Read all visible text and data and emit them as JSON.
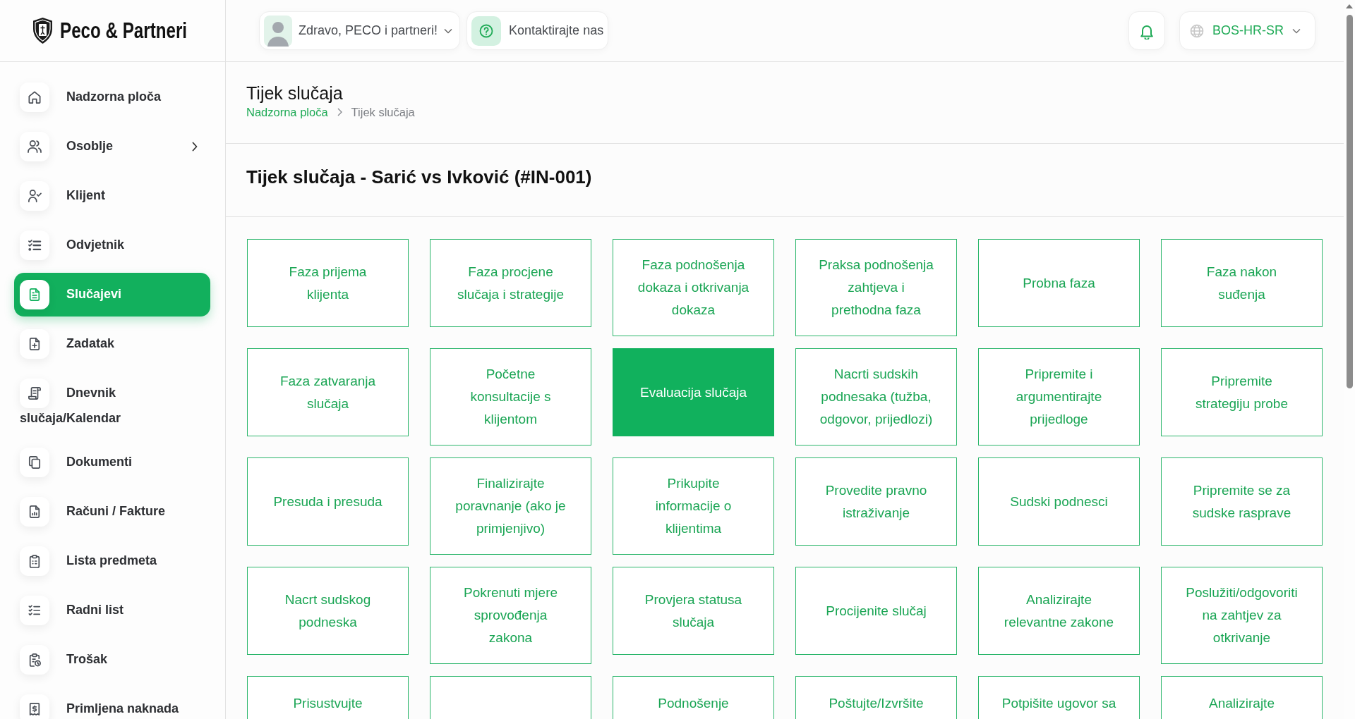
{
  "brand": {
    "name": "Peco & Partneri"
  },
  "sidebar": {
    "items": [
      {
        "label": "Nadzorna ploča",
        "selected": false,
        "has_submenu": false
      },
      {
        "label": "Osoblje",
        "selected": false,
        "has_submenu": true
      },
      {
        "label": "Klijent",
        "selected": false,
        "has_submenu": false
      },
      {
        "label": "Odvjetnik",
        "selected": false,
        "has_submenu": false
      },
      {
        "label": "Slučajevi",
        "selected": true,
        "has_submenu": false
      },
      {
        "label": "Zadatak",
        "selected": false,
        "has_submenu": false
      },
      {
        "label": "Dnevnik slučaja/Kalendar",
        "selected": false,
        "has_submenu": false
      },
      {
        "label": "Dokumenti",
        "selected": false,
        "has_submenu": false
      },
      {
        "label": "Računi / Fakture",
        "selected": false,
        "has_submenu": false
      },
      {
        "label": "Lista predmeta",
        "selected": false,
        "has_submenu": false
      },
      {
        "label": "Radni list",
        "selected": false,
        "has_submenu": false
      },
      {
        "label": "Trošak",
        "selected": false,
        "has_submenu": false
      },
      {
        "label": "Primljena naknada",
        "selected": false,
        "has_submenu": false
      }
    ]
  },
  "topbar": {
    "user_menu": {
      "greeting": "Zdravo, PECO i partneri!"
    },
    "contact_button": {
      "label": "Kontaktirajte nas"
    },
    "language": {
      "label": "BOS-HR-SR"
    }
  },
  "page_header": {
    "title": "Tijek slučaja",
    "breadcrumb": [
      {
        "label": "Nadzorna ploča",
        "current": false
      },
      {
        "label": "Tijek slučaja",
        "current": true
      }
    ]
  },
  "case": {
    "heading": "Tijek slučaja - Sarić vs Ivković (#IN-001)",
    "phases": [
      {
        "label": "Faza prijema klijenta",
        "selected": false,
        "kind": "full"
      },
      {
        "label": "Faza procjene slučaja i strategije",
        "selected": false,
        "kind": "full"
      },
      {
        "label": "Faza podnošenja dokaza i otkrivanja dokaza",
        "selected": false,
        "kind": "full"
      },
      {
        "label": "Praksa podnošenja zahtjeva i prethodna faza",
        "selected": false,
        "kind": "full"
      },
      {
        "label": "Probna faza",
        "selected": false,
        "kind": "full"
      },
      {
        "label": "Faza nakon suđenja",
        "selected": false,
        "kind": "full"
      },
      {
        "label": "Faza zatvaranja slučaja",
        "selected": false,
        "kind": "full"
      },
      {
        "label": "Početne konsultacije s klijentom",
        "selected": false,
        "kind": "full"
      },
      {
        "label": "Evaluacija slučaja",
        "selected": true,
        "kind": "full"
      },
      {
        "label": "Nacrti sudskih podnesaka (tužba, odgovor, prijedlozi)",
        "selected": false,
        "kind": "full"
      },
      {
        "label": "Pripremite i argumentirajte prijedloge",
        "selected": false,
        "kind": "full"
      },
      {
        "label": "Pripremite strategiju probe",
        "selected": false,
        "kind": "full"
      },
      {
        "label": "Presuda i presuda",
        "selected": false,
        "kind": "full"
      },
      {
        "label": "Finalizirajte poravnanje (ako je primjenjivo)",
        "selected": false,
        "kind": "full"
      },
      {
        "label": "Prikupite informacije o klijentima",
        "selected": false,
        "kind": "full"
      },
      {
        "label": "Provedite pravno istraživanje",
        "selected": false,
        "kind": "full"
      },
      {
        "label": "Sudski podnesci",
        "selected": false,
        "kind": "full"
      },
      {
        "label": "Pripremite se za sudske rasprave",
        "selected": false,
        "kind": "full"
      },
      {
        "label": "Nacrt sudskog podneska",
        "selected": false,
        "kind": "full"
      },
      {
        "label": "Pokrenuti mjere sprovođenja zakona",
        "selected": false,
        "kind": "full"
      },
      {
        "label": "Provjera statusa slučaja",
        "selected": false,
        "kind": "full"
      },
      {
        "label": "Procijenite slučaj",
        "selected": false,
        "kind": "full"
      },
      {
        "label": "Analizirajte relevantne zakone",
        "selected": false,
        "kind": "full"
      },
      {
        "label": "Poslužiti/odgovoriti na zahtjev za otkrivanje",
        "selected": false,
        "kind": "full"
      },
      {
        "label": "Prisustvujte",
        "selected": false,
        "kind": "partial"
      },
      {
        "selected": false,
        "kind": "partial"
      },
      {
        "label": "Podnošenje",
        "selected": false,
        "kind": "partial"
      },
      {
        "label": "Poštujte/Izvršite",
        "selected": false,
        "kind": "partial"
      },
      {
        "label": "Potpišite ugovor sa",
        "selected": false,
        "kind": "partial"
      },
      {
        "label": "Analizirajte",
        "selected": false,
        "kind": "partial"
      }
    ]
  }
}
